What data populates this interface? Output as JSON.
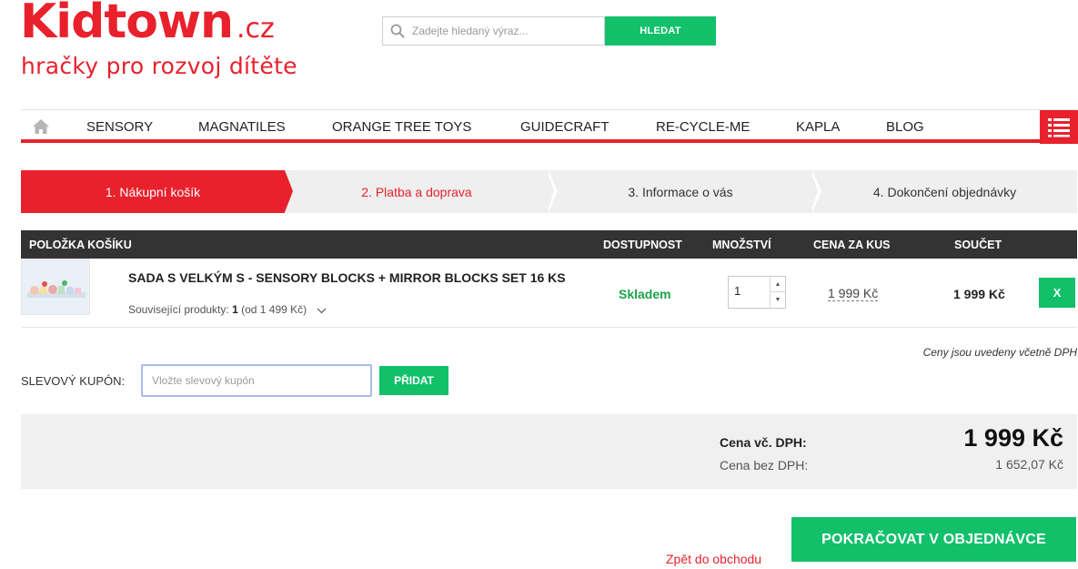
{
  "brand": {
    "logo_word": "Kidtown",
    "logo_tld": ".cz",
    "tagline": "hračky pro rozvoj dítěte",
    "color": "#e8212c"
  },
  "search": {
    "placeholder": "Zadejte hledaný výraz...",
    "button_label": "HLEDAT",
    "icon": "search-icon"
  },
  "nav": {
    "home_icon": "home-icon",
    "items": [
      "SENSORY",
      "MAGNATILES",
      "ORANGE TREE TOYS",
      "GUIDECRAFT",
      "RE-CYCLE-ME",
      "KAPLA",
      "BLOG"
    ],
    "menu_icon": "list-menu-icon"
  },
  "steps": [
    {
      "label": "1. Nákupní košík",
      "state": "active"
    },
    {
      "label": "2. Platba a doprava",
      "state": "next"
    },
    {
      "label": "3. Informace o vás",
      "state": "inactive"
    },
    {
      "label": "4. Dokončení objednávky",
      "state": "inactive"
    }
  ],
  "cart": {
    "headers": {
      "item": "POLOŽKA KOŠÍKU",
      "availability": "DOSTUPNOST",
      "quantity": "MNOŽSTVÍ",
      "unit_price": "CENA ZA KUS",
      "total": "SOUČET"
    },
    "items": [
      {
        "name": "SADA S VELKÝM S - SENSORY BLOCKS + MIRROR BLOCKS SET 16 KS",
        "related_prefix": "Související produkty:",
        "related_count": "1",
        "related_suffix": "(od 1 499 Kč)",
        "availability": "Skladem",
        "quantity": "1",
        "unit_price": "1 999 Kč",
        "total": "1 999 Kč",
        "remove_label": "X"
      }
    ],
    "vat_note": "Ceny jsou uvedeny včetně DPH"
  },
  "coupon": {
    "label": "SLEVOVÝ KUPÓN:",
    "placeholder": "Vložte slevový kupón",
    "button_label": "PŘIDAT"
  },
  "summary": {
    "incl_vat_label": "Cena vč. DPH:",
    "incl_vat_value": "1 999 Kč",
    "excl_vat_label": "Cena bez DPH:",
    "excl_vat_value": "1 652,07 Kč"
  },
  "actions": {
    "continue_label": "POKRAČOVAT V OBJEDNÁVCE",
    "back_label": "Zpět do obchodu"
  },
  "colors": {
    "accent_red": "#e8212c",
    "action_green": "#12c06a",
    "stock_green": "#1aa44a",
    "header_dark": "#333333"
  }
}
